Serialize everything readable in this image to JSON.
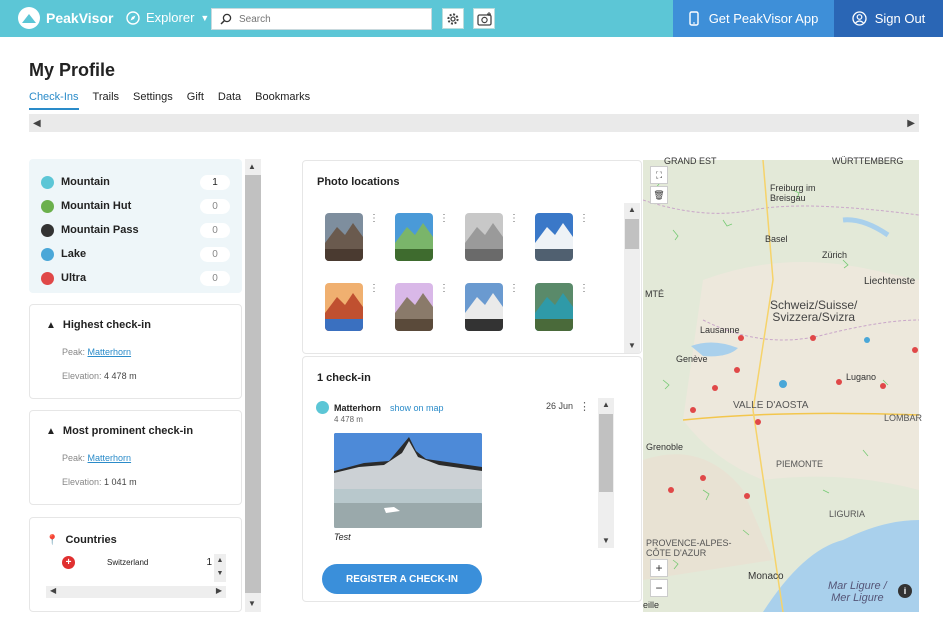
{
  "topbar": {
    "brand": "PeakVisor",
    "explorer": "Explorer",
    "search_placeholder": "Search",
    "app_button": "Get PeakVisor App",
    "signout": "Sign Out"
  },
  "profile": {
    "title": "My Profile",
    "tabs": [
      "Check-Ins",
      "Trails",
      "Settings",
      "Gift",
      "Data",
      "Bookmarks"
    ],
    "active_tab": "Check-Ins"
  },
  "categories": [
    {
      "name": "Mountain",
      "count": "1",
      "color": "#5cc6d6"
    },
    {
      "name": "Mountain Hut",
      "count": "0",
      "color": "#6bb04c"
    },
    {
      "name": "Mountain Pass",
      "count": "0",
      "color": "#333333"
    },
    {
      "name": "Lake",
      "count": "0",
      "color": "#4aa7d8"
    },
    {
      "name": "Ultra",
      "count": "0",
      "color": "#e04848"
    }
  ],
  "highest": {
    "title": "Highest check-in",
    "peak_label": "Peak:",
    "peak": "Matterhorn",
    "elev_label": "Elevation:",
    "elev": "4 478 m"
  },
  "prominent": {
    "title": "Most prominent check-in",
    "peak_label": "Peak:",
    "peak": "Matterhorn",
    "elev_label": "Elevation:",
    "elev": "1 041 m"
  },
  "countries": {
    "title": "Countries",
    "rows": [
      {
        "name": "Switzerland",
        "count": "1"
      }
    ]
  },
  "photos": {
    "title": "Photo locations"
  },
  "checkins": {
    "title": "1 check-in",
    "item": {
      "name": "Matterhorn",
      "show_on_map": "show on map",
      "date": "26 Jun",
      "elev": "4 478 m",
      "caption": "Test"
    },
    "register": "REGISTER A CHECK-IN"
  },
  "map": {
    "labels": {
      "grand_est": "GRAND EST",
      "wurttemberg": "WÜRTTEMBERG",
      "freiburg": "Freiburg im\nBreisgau",
      "basel": "Basel",
      "zurich": "Zürich",
      "liechtenstein": "Liechtenste",
      "schweiz": "Schweiz/Suisse/\nSvizzera/Svizra",
      "lausanne": "Lausanne",
      "geneve": "Genève",
      "lugano": "Lugano",
      "valle": "VALLE D'AOSTA",
      "lombar": "LOMBAR",
      "grenoble": "Grenoble",
      "piemonte": "PIEMONTE",
      "liguria": "LIGURIA",
      "paca": "PROVENCE-ALPES-\nCÔTE D'AZUR",
      "monaco": "Monaco",
      "mar": "Mar Ligure /\nMer Ligure",
      "marseille": "eille",
      "mte": "MTÉ"
    }
  }
}
